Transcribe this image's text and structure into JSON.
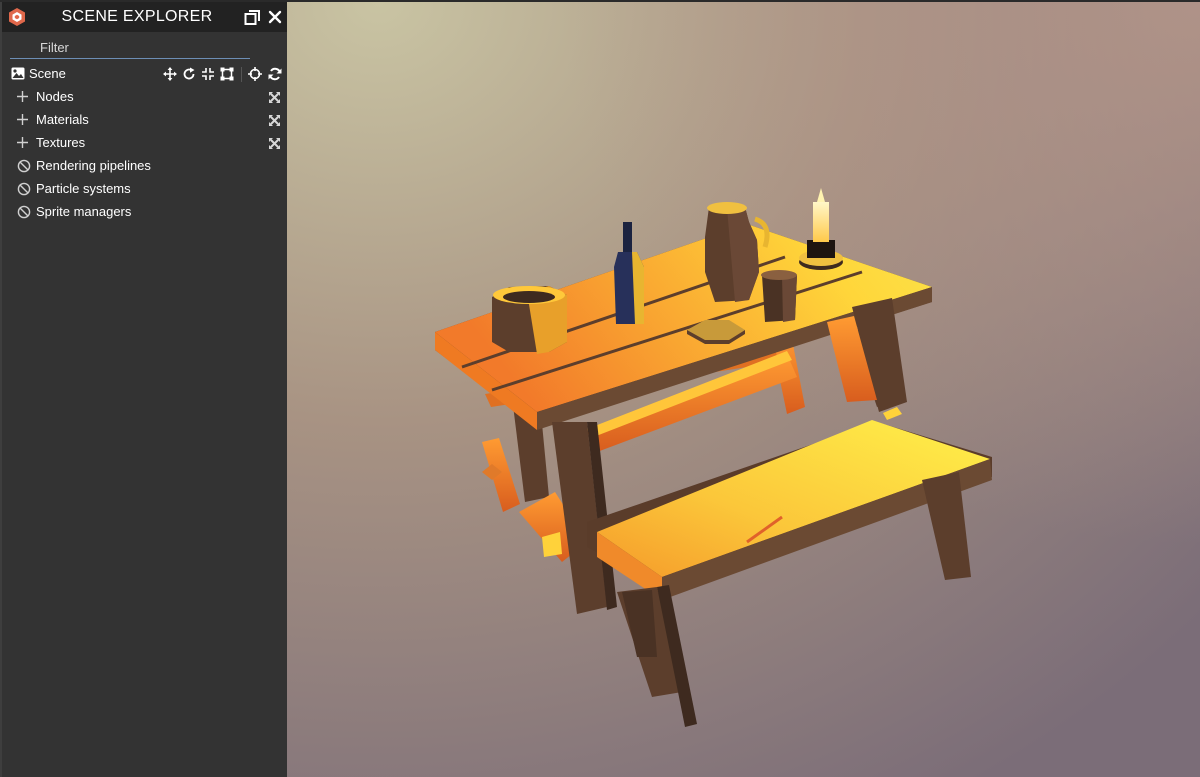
{
  "explorer": {
    "title": "SCENE EXPLORER",
    "logo": "babylon-logo-icon",
    "popout_icon": "popout-icon",
    "close_icon": "close-icon",
    "filter_placeholder": "Filter",
    "scene_label": "Scene",
    "scene_tools": [
      "move-gizmo-icon",
      "rotate-gizmo-icon",
      "scale-gizmo-icon",
      "bounding-box-gizmo-icon",
      "target-icon",
      "refresh-icon"
    ],
    "sections": [
      {
        "label": "Nodes",
        "icon": "plus-icon",
        "action_icon": "expand-all-icon"
      },
      {
        "label": "Materials",
        "icon": "plus-icon",
        "action_icon": "expand-all-icon"
      },
      {
        "label": "Textures",
        "icon": "plus-icon",
        "action_icon": "expand-all-icon"
      },
      {
        "label": "Rendering pipelines",
        "icon": "disabled-icon"
      },
      {
        "label": "Particle systems",
        "icon": "disabled-icon"
      },
      {
        "label": "Sprite managers",
        "icon": "disabled-icon"
      }
    ]
  },
  "colors": {
    "panel_bg": "#333333",
    "header_bg": "#222222",
    "accent": "#6d8eb5",
    "logo_red": "#e0684b",
    "viewport_top_left": "#c4bfa0",
    "viewport_top_right": "#b09488",
    "viewport_bottom": "#7d6f79",
    "wood_light": "#ffd83a",
    "wood_orange": "#f59a2a",
    "wood_dark": "#6b4a33"
  },
  "viewport": {
    "content": "low-poly tavern table with bench, bowl, bottle, jug, cup and candle"
  }
}
